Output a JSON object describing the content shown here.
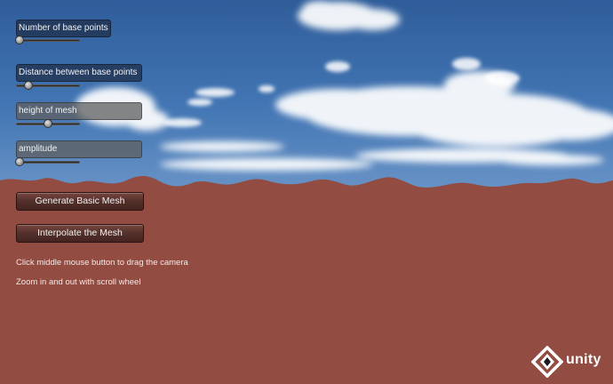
{
  "controls": {
    "base_points": {
      "label": "Number of base points",
      "slider_value": 0.05
    },
    "distance": {
      "label": "Distance between base points",
      "slider_value": 0.2
    },
    "height": {
      "label": "height of mesh",
      "slider_value": 0.5
    },
    "amplitude": {
      "label": "amplitude",
      "slider_value": 0.05
    }
  },
  "buttons": {
    "generate": "Generate Basic Mesh",
    "interpolate": "Interpolate the Mesh"
  },
  "hints": {
    "camera": "Click middle mouse button to drag the camera",
    "zoom": "Zoom in and out with scroll wheel"
  },
  "logo": {
    "word": "unity"
  },
  "colors": {
    "terrain": "#924c42",
    "sky_top": "#2f5d9a",
    "sky_bottom": "#d8e4f0"
  }
}
